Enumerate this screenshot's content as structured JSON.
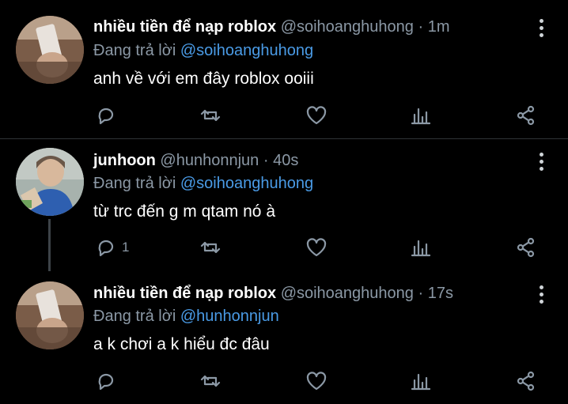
{
  "tweets": [
    {
      "name": "nhiều tiền để nạp roblox",
      "handle": "@soihoanghuhong",
      "separator": "·",
      "time": "1m",
      "reply_prefix": "Đang trả lời",
      "reply_to": "@soihoanghuhong",
      "text": "anh về với em đây roblox ooiii",
      "reply_count": ""
    },
    {
      "name": "junhoon",
      "handle": "@hunhonnjun",
      "separator": "·",
      "time": "40s",
      "reply_prefix": "Đang trả lời",
      "reply_to": "@soihoanghuhong",
      "text": "từ trc đến g m qtam nó à",
      "reply_count": "1"
    },
    {
      "name": "nhiều tiền để nạp roblox",
      "handle": "@soihoanghuhong",
      "separator": "·",
      "time": "17s",
      "reply_prefix": "Đang trả lời",
      "reply_to": "@hunhonnjun",
      "text": "a k chơi a k hiểu đc đâu",
      "reply_count": ""
    }
  ],
  "icons": [
    "reply-icon",
    "retweet-icon",
    "like-icon",
    "analytics-icon",
    "share-icon",
    "more-options-icon"
  ],
  "colors": {
    "background": "#000000",
    "muted": "#8b98a5",
    "mention": "#4a9be6",
    "divider": "#2f3336"
  }
}
